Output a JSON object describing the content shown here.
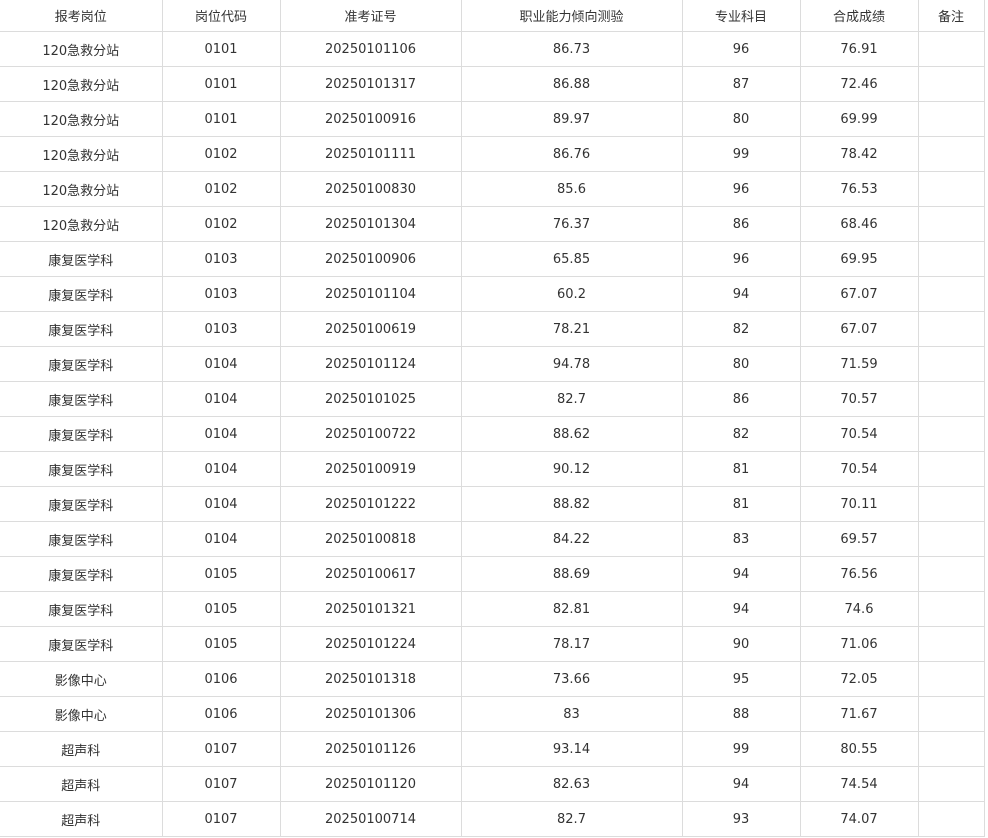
{
  "table": {
    "headers": [
      "报考岗位",
      "岗位代码",
      "准考证号",
      "职业能力倾向测验",
      "专业科目",
      "合成成绩",
      "备注"
    ],
    "rows": [
      [
        "120急救分站",
        "0101",
        "20250101106",
        "86.73",
        "96",
        "76.91",
        ""
      ],
      [
        "120急救分站",
        "0101",
        "20250101317",
        "86.88",
        "87",
        "72.46",
        ""
      ],
      [
        "120急救分站",
        "0101",
        "20250100916",
        "89.97",
        "80",
        "69.99",
        ""
      ],
      [
        "120急救分站",
        "0102",
        "20250101111",
        "86.76",
        "99",
        "78.42",
        ""
      ],
      [
        "120急救分站",
        "0102",
        "20250100830",
        "85.6",
        "96",
        "76.53",
        ""
      ],
      [
        "120急救分站",
        "0102",
        "20250101304",
        "76.37",
        "86",
        "68.46",
        ""
      ],
      [
        "康复医学科",
        "0103",
        "20250100906",
        "65.85",
        "96",
        "69.95",
        ""
      ],
      [
        "康复医学科",
        "0103",
        "20250101104",
        "60.2",
        "94",
        "67.07",
        ""
      ],
      [
        "康复医学科",
        "0103",
        "20250100619",
        "78.21",
        "82",
        "67.07",
        ""
      ],
      [
        "康复医学科",
        "0104",
        "20250101124",
        "94.78",
        "80",
        "71.59",
        ""
      ],
      [
        "康复医学科",
        "0104",
        "20250101025",
        "82.7",
        "86",
        "70.57",
        ""
      ],
      [
        "康复医学科",
        "0104",
        "20250100722",
        "88.62",
        "82",
        "70.54",
        ""
      ],
      [
        "康复医学科",
        "0104",
        "20250100919",
        "90.12",
        "81",
        "70.54",
        ""
      ],
      [
        "康复医学科",
        "0104",
        "20250101222",
        "88.82",
        "81",
        "70.11",
        ""
      ],
      [
        "康复医学科",
        "0104",
        "20250100818",
        "84.22",
        "83",
        "69.57",
        ""
      ],
      [
        "康复医学科",
        "0105",
        "20250100617",
        "88.69",
        "94",
        "76.56",
        ""
      ],
      [
        "康复医学科",
        "0105",
        "20250101321",
        "82.81",
        "94",
        "74.6",
        ""
      ],
      [
        "康复医学科",
        "0105",
        "20250101224",
        "78.17",
        "90",
        "71.06",
        ""
      ],
      [
        "影像中心",
        "0106",
        "20250101318",
        "73.66",
        "95",
        "72.05",
        ""
      ],
      [
        "影像中心",
        "0106",
        "20250101306",
        "83",
        "88",
        "71.67",
        ""
      ],
      [
        "超声科",
        "0107",
        "20250101126",
        "93.14",
        "99",
        "80.55",
        ""
      ],
      [
        "超声科",
        "0107",
        "20250101120",
        "82.63",
        "94",
        "74.54",
        ""
      ],
      [
        "超声科",
        "0107",
        "20250100714",
        "82.7",
        "93",
        "74.07",
        ""
      ]
    ]
  }
}
